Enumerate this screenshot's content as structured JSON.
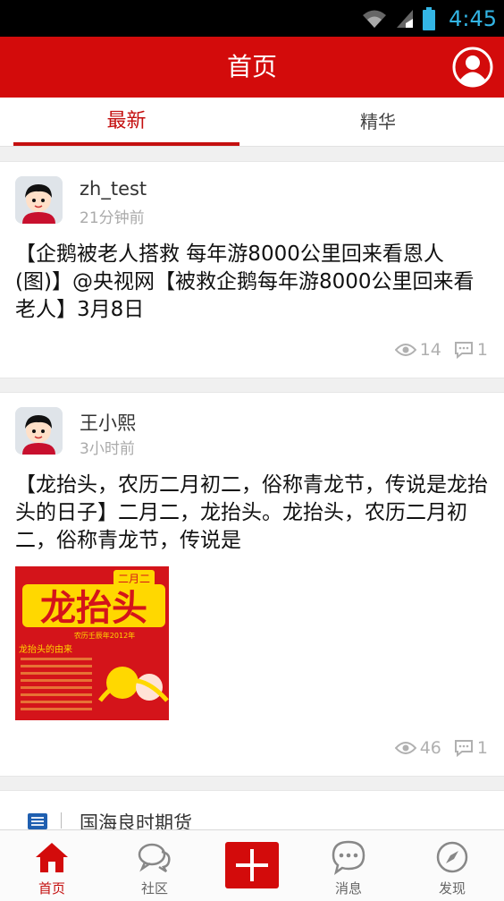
{
  "status_bar": {
    "time": "4:45",
    "accent": "#33b5e5"
  },
  "header": {
    "title": "首页",
    "profile_icon": "user-icon",
    "color": "#d30b0b"
  },
  "tabs": [
    {
      "label": "最新",
      "active": true
    },
    {
      "label": "精华",
      "active": false
    }
  ],
  "posts": [
    {
      "user": "zh_test",
      "time": "21分钟前",
      "content": "【企鹅被老人搭救 每年游8000公里回来看恩人(图)】@央视网【被救企鹅每年游8000公里回来看老人】3月8日",
      "views": "14",
      "comments": "1"
    },
    {
      "user": "王小熙",
      "time": "3小时前",
      "content": "【龙抬头，农历二月初二，俗称青龙节，传说是龙抬头的日子】二月二，龙抬头。龙抬头，农历二月初二，俗称青龙节，传说是",
      "image": {
        "title": "龙抬头",
        "banner": "二月二",
        "subtitle": "农历壬辰年2012年",
        "caption": "龙抬头的由来"
      },
      "views": "46",
      "comments": "1"
    },
    {
      "user": "国海良时期货"
    }
  ],
  "bottom_nav": [
    {
      "label": "首页",
      "icon": "home-icon",
      "active": true
    },
    {
      "label": "社区",
      "icon": "chat-bubbles-icon",
      "active": false
    },
    {
      "label": "",
      "icon": "plus-icon",
      "active": false
    },
    {
      "label": "消息",
      "icon": "message-icon",
      "active": false
    },
    {
      "label": "发现",
      "icon": "compass-icon",
      "active": false
    }
  ]
}
